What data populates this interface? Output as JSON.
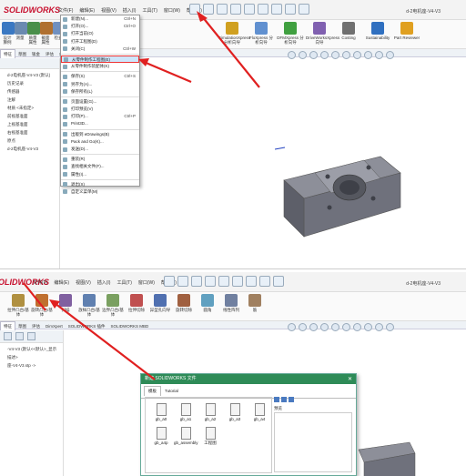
{
  "top": {
    "logo": "SOLIDWORKS",
    "menus": [
      "文件(F)",
      "编辑(E)",
      "视图(V)",
      "插入(I)",
      "工具(T)",
      "窗口(W)",
      "帮助(H)"
    ],
    "window_title": "d-2电机座-V4-V3",
    "ribbon": [
      {
        "label": "设计算例",
        "color": "#3a78c2"
      },
      {
        "label": "测量",
        "color": "#6a8ab0"
      },
      {
        "label": "质量属性",
        "color": "#4a8f4a"
      },
      {
        "label": "截面属性",
        "color": "#b07030"
      },
      {
        "label": "检查",
        "color": "#7090c0"
      }
    ],
    "ribbon_right": [
      {
        "label": "SimulationXpress 分析向导",
        "color": "#d0a020"
      },
      {
        "label": "FloXpress 分析向导",
        "color": "#6090d0"
      },
      {
        "label": "DFMXpress 分析向导",
        "color": "#40a040"
      },
      {
        "label": "DriveWorksXpress 向导",
        "color": "#8060b0"
      },
      {
        "label": "Costing",
        "color": "#707070"
      },
      {
        "label": "Sustainability",
        "color": "#3070c0"
      },
      {
        "label": "Part Reviewer",
        "color": "#e0a020"
      }
    ],
    "tabs": [
      "特征",
      "草图",
      "钣金",
      "评估",
      "SOLIDWORKS MBD"
    ],
    "tree": [
      "d-2电机座-V4-V3 (默认)",
      "历史记录",
      "传感器",
      "注解",
      "材质 <未指定>",
      "前视基准面",
      "上视基准面",
      "右视基准面",
      "原点",
      "d-2电机座-V4-V3"
    ],
    "file_menu": [
      {
        "label": "新建(N)...",
        "shortcut": "Ctrl+N",
        "hl": false
      },
      {
        "label": "打开(O)...",
        "shortcut": "Ctrl+O",
        "hl": false
      },
      {
        "label": "打开当前(O)",
        "shortcut": "",
        "hl": false
      },
      {
        "label": "打开工程图(D)",
        "shortcut": "",
        "hl": false
      },
      {
        "label": "关闭(C)",
        "shortcut": "Ctrl+W",
        "hl": false
      },
      {
        "label": "从零件制作工程图(E)",
        "shortcut": "",
        "hl": true
      },
      {
        "label": "从零件制作装配体(K)",
        "shortcut": "",
        "hl": false
      },
      {
        "label": "保存(S)",
        "shortcut": "Ctrl+S",
        "hl": false
      },
      {
        "label": "另存为(A)...",
        "shortcut": "",
        "hl": false
      },
      {
        "label": "保存所有(L)",
        "shortcut": "",
        "hl": false
      },
      {
        "label": "页面设置(G)...",
        "shortcut": "",
        "hl": false
      },
      {
        "label": "打印预览(V)",
        "shortcut": "",
        "hl": false
      },
      {
        "label": "打印(P)...",
        "shortcut": "Ctrl+P",
        "hl": false
      },
      {
        "label": "Print3D...",
        "shortcut": "",
        "hl": false
      },
      {
        "label": "出版到 eDrawings(B)",
        "shortcut": "",
        "hl": false
      },
      {
        "label": "Pack and Go(K)...",
        "shortcut": "",
        "hl": false
      },
      {
        "label": "发送(D)...",
        "shortcut": "",
        "hl": false
      },
      {
        "label": "重装(R)",
        "shortcut": "",
        "hl": false
      },
      {
        "label": "查找相关文件(F)...",
        "shortcut": "",
        "hl": false
      },
      {
        "label": "属性(I)...",
        "shortcut": "",
        "hl": false
      },
      {
        "label": "退出(X)",
        "shortcut": "",
        "hl": false
      },
      {
        "label": "自定义菜单(M)",
        "shortcut": "",
        "hl": false
      }
    ]
  },
  "bot": {
    "logo": "SOLIDWORKS",
    "menus": [
      "文件(F)",
      "编辑(E)",
      "视图(V)",
      "插入(I)",
      "工具(T)",
      "窗口(W)",
      "帮助(H)"
    ],
    "window_title": "d-2电机座-V4-V3",
    "ribbon": [
      {
        "label": "拉伸凸台/基体",
        "color": "#b09040"
      },
      {
        "label": "旋转凸台/基体",
        "color": "#c07030"
      },
      {
        "label": "扫描",
        "color": "#8060a0"
      },
      {
        "label": "放样凸台/基体",
        "color": "#6080b0"
      },
      {
        "label": "边界凸台/基体",
        "color": "#7aa060"
      },
      {
        "label": "拉伸切除",
        "color": "#c05050"
      },
      {
        "label": "异型孔向导",
        "color": "#5070b0"
      },
      {
        "label": "旋转切除",
        "color": "#a06040"
      },
      {
        "label": "圆角",
        "color": "#60a0c0"
      },
      {
        "label": "线性阵列",
        "color": "#7080a0"
      },
      {
        "label": "筋",
        "color": "#a08060"
      }
    ],
    "tabs": [
      "特征",
      "草图",
      "评估",
      "DimXpert",
      "SOLIDWORKS 插件",
      "SOLIDWORKS MBD"
    ],
    "tree": [
      "-V4-V3 (默认<<默认>_显示",
      "",
      "",
      "",
      "描述>",
      "",
      "",
      "",
      "",
      "座-V4-V3.stp ->"
    ],
    "dialog": {
      "title": "新建 SOLIDWORKS 文件",
      "tabs": [
        "模板",
        "Tutorial"
      ],
      "files": [
        "gb_a0",
        "gb_a1",
        "gb_a2",
        "gb_a3",
        "gb_a4",
        "gb_a4p",
        "gb_assembly",
        "工程图"
      ],
      "preview_label": "预览"
    }
  }
}
